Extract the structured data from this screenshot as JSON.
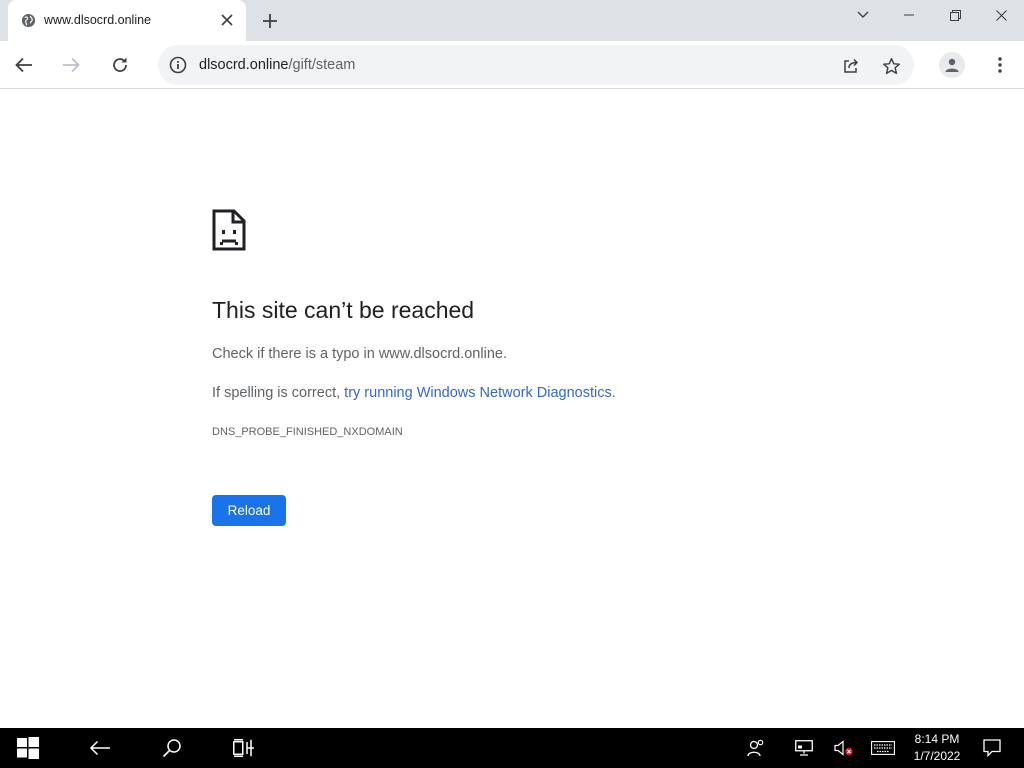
{
  "tab": {
    "title": "www.dlsocrd.online",
    "favicon": "globe-icon",
    "close_icon": "close-icon"
  },
  "new_tab_icon": "plus-icon",
  "window_controls": [
    "chevron-down-icon",
    "minimize-icon",
    "restore-icon",
    "close-icon"
  ],
  "toolbar": {
    "back_icon": "back-arrow-icon",
    "forward_icon": "forward-arrow-icon",
    "reload_icon": "reload-icon"
  },
  "omnibox": {
    "host": "dlsocrd.online",
    "path": "/gift/steam",
    "info_icon": "info-icon",
    "share_icon": "share-icon",
    "star_icon": "star-icon"
  },
  "error_page": {
    "icon": "sad-page-icon",
    "title": "This site can’t be reached",
    "line1": "Check if there is a typo in www.dlsocrd.online.",
    "line2_prefix": "If spelling is correct, ",
    "line2_link": "try running Windows Network Diagnostics",
    "line2_suffix": ".",
    "error_code": "DNS_PROBE_FINISHED_NXDOMAIN",
    "reload_label": "Reload"
  },
  "taskbar": {
    "time": "8:14 PM",
    "date": "1/7/2022"
  },
  "colors": {
    "accent": "#1a73e8",
    "tabstrip": "#dee1e6",
    "omnibox": "#f1f3f4",
    "taskbar": "#000000"
  }
}
